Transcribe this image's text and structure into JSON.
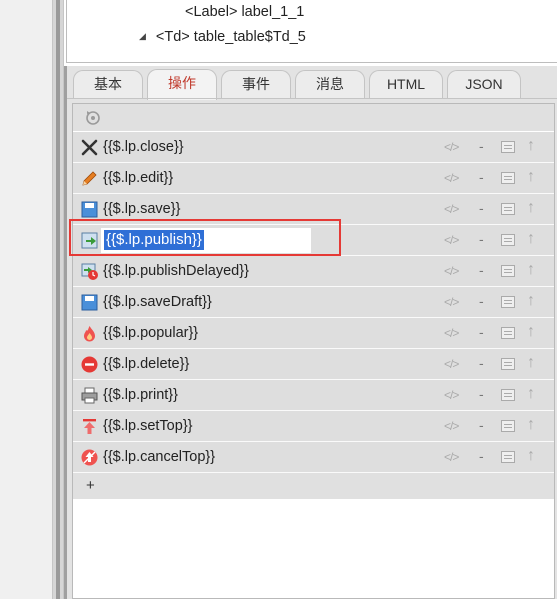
{
  "tree": {
    "row1": "<Label> label_1_1",
    "row2": "<Td> table_table$Td_5",
    "row2_toggle": "◢"
  },
  "tabs": [
    {
      "label": "基本",
      "active": false
    },
    {
      "label": "操作",
      "active": true
    },
    {
      "label": "事件",
      "active": false
    },
    {
      "label": "消息",
      "active": false
    },
    {
      "label": "HTML",
      "active": false
    },
    {
      "label": "JSON",
      "active": false
    }
  ],
  "actions": [
    {
      "label": "{{$.lp.close}}",
      "icon": "close-icon"
    },
    {
      "label": "{{$.lp.edit}}",
      "icon": "pencil-icon"
    },
    {
      "label": "{{$.lp.save}}",
      "icon": "save-icon"
    },
    {
      "label": "{{$.lp.publish}}",
      "icon": "publish-icon",
      "editing": true
    },
    {
      "label": "{{$.lp.publishDelayed}}",
      "icon": "publish-delayed-icon"
    },
    {
      "label": "{{$.lp.saveDraft}}",
      "icon": "save-draft-icon"
    },
    {
      "label": "{{$.lp.popular}}",
      "icon": "fire-icon"
    },
    {
      "label": "{{$.lp.delete}}",
      "icon": "delete-icon"
    },
    {
      "label": "{{$.lp.print}}",
      "icon": "print-icon"
    },
    {
      "label": "{{$.lp.setTop}}",
      "icon": "set-top-icon"
    },
    {
      "label": "{{$.lp.cancelTop}}",
      "icon": "cancel-top-icon"
    }
  ],
  "row_controls": {
    "code": "</>",
    "dash": "-",
    "up": "↑"
  },
  "add_label": "+",
  "colors": {
    "tab_active_text": "#c0392b",
    "selection": "#2f6fd6",
    "highlight_box": "#e53935"
  }
}
